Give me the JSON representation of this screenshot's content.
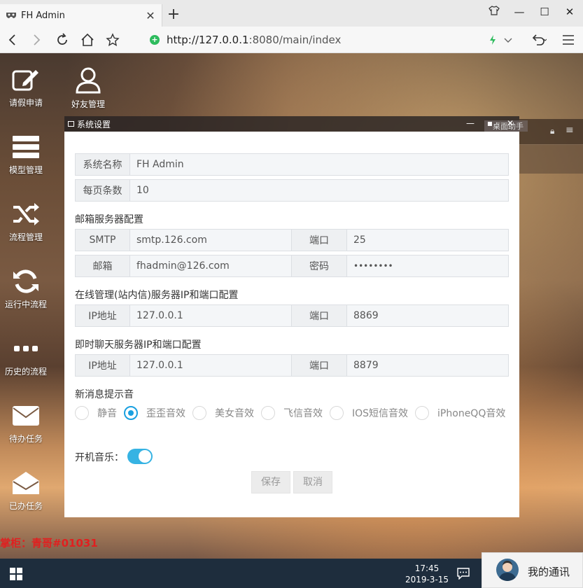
{
  "browser": {
    "tab_title": "FH Admin",
    "url_host": "http://127.0.0.1",
    "url_rest": ":8080/main/index"
  },
  "desktop": {
    "icons": [
      {
        "label": "请假申请",
        "icon": "edit-icon"
      },
      {
        "label": "好友管理",
        "icon": "user-icon"
      },
      {
        "label": "模型管理",
        "icon": "server-icon"
      },
      {
        "label": "流程管理",
        "icon": "shuffle-icon"
      },
      {
        "label": "运行中流程",
        "icon": "refresh-icon"
      },
      {
        "label": "历史的流程",
        "icon": "dots-icon"
      },
      {
        "label": "待办任务",
        "icon": "envelope-icon"
      },
      {
        "label": "已办任务",
        "icon": "envelope-open-icon"
      }
    ],
    "marquee": "掌柜：青哥#01031",
    "ghost_tab": "桌面助手"
  },
  "modal": {
    "title": "系统设置",
    "system_name_label": "系统名称",
    "system_name_value": "FH Admin",
    "page_size_label": "每页条数",
    "page_size_value": "10",
    "mail_section": "邮箱服务器配置",
    "smtp_label": "SMTP",
    "smtp_value": "smtp.126.com",
    "smtp_port_label": "端口",
    "smtp_port_value": "25",
    "email_label": "邮箱",
    "email_value": "fhadmin@126.com",
    "password_label": "密码",
    "password_value": "••••••••",
    "online_section": "在线管理(站内信)服务器IP和端口配置",
    "online_ip_label": "IP地址",
    "online_ip_value": "127.0.0.1",
    "online_port_label": "端口",
    "online_port_value": "8869",
    "im_section": "即时聊天服务器IP和端口配置",
    "im_ip_label": "IP地址",
    "im_ip_value": "127.0.0.1",
    "im_port_label": "端口",
    "im_port_value": "8879",
    "sound_section": "新消息提示音",
    "sounds": [
      "静音",
      "歪歪音效",
      "美女音效",
      "飞信音效",
      "IOS短信音效",
      "iPhoneQQ音效"
    ],
    "selected_sound": "歪歪音效",
    "boot_music_label": "开机音乐：",
    "boot_music_on": true,
    "save_label": "保存",
    "cancel_label": "取消"
  },
  "taskbar": {
    "time": "17:45",
    "date": "2019-3-15",
    "contacts_label": "我的通讯"
  },
  "colors": {
    "accent": "#1aa0e0",
    "toggle": "#36b3e3",
    "taskbar": "#1e2d3d",
    "marquee": "#e02020"
  }
}
